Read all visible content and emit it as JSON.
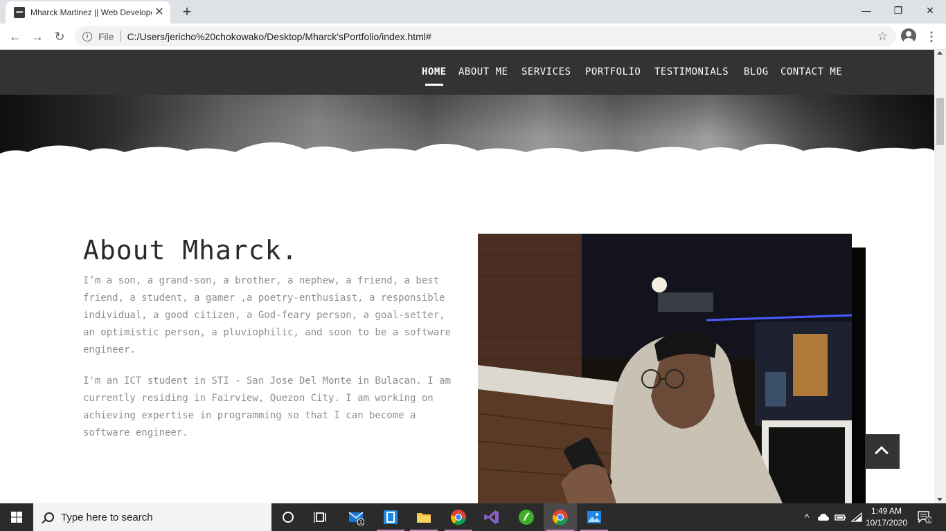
{
  "browser": {
    "tab_title": "Mharck Martinez || Web Developer",
    "tab_close": "✕",
    "new_tab": "+",
    "window_controls": {
      "minimize": "—",
      "restore": "❐",
      "close": "✕"
    },
    "back": "←",
    "forward": "→",
    "reload": "↻",
    "info_icon": "i",
    "scheme_label": "File",
    "url": "C:/Users/jericho%20chokowako/Desktop/Mharck'sPortfolio/index.html#",
    "bookmark_star": "☆",
    "menu": "⋮"
  },
  "nav": {
    "items": [
      {
        "label": "HOME",
        "active": true
      },
      {
        "label": "ABOUT ME",
        "active": false
      },
      {
        "label": "SERVICES",
        "active": false
      },
      {
        "label": "PORTFOLIO",
        "active": false
      },
      {
        "label": "TESTIMONIALS",
        "active": false
      },
      {
        "label": "BLOG",
        "active": false
      },
      {
        "label": "CONTACT ME",
        "active": false
      }
    ]
  },
  "about": {
    "heading": "About Mharck.",
    "paragraph1": "I’m a son, a grand-son, a brother, a nephew, a friend, a best friend, a student, a gamer ,a poetry-enthusiast, a responsible individual, a good citizen, a God-feary person, a goal-setter, an optimistic person, a pluviophilic, and soon to be a software engineer.",
    "paragraph2": "I'm an ICT student in STI - San Jose Del Monte in Bulacan. I am currently residing in Fairview, Quezon City. I am working on achieving expertise in programming so that I can become a software engineer."
  },
  "taskbar": {
    "search_placeholder": "Type here to search",
    "mail_badge": "1",
    "time": "1:49 AM",
    "date": "10/17/2020",
    "notification_badge": "1",
    "tray_chevron": "^"
  },
  "colors": {
    "navbar_bg": "#333333",
    "accent": "#ffffff",
    "body_text": "#8e8e8e",
    "heading_text": "#2a2a2a"
  }
}
